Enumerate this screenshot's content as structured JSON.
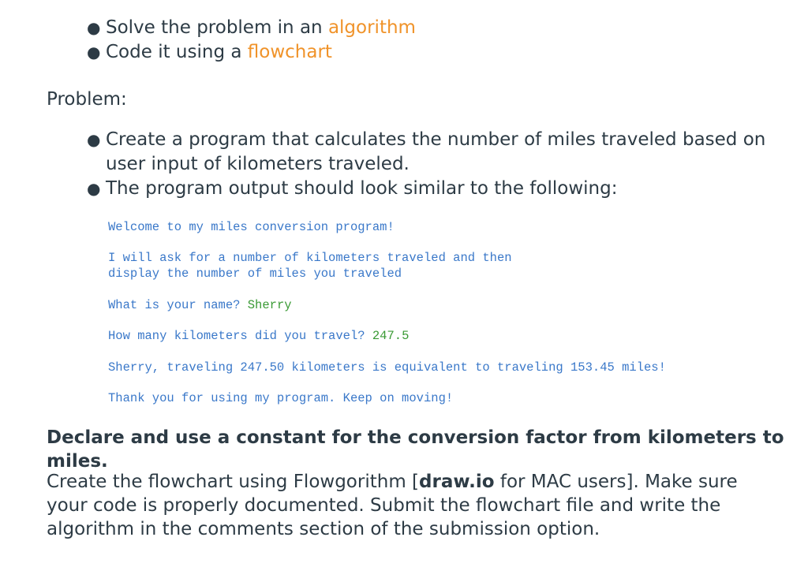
{
  "intro_list": [
    {
      "text": "Solve the problem in an ",
      "highlight": "algorithm"
    },
    {
      "text": "Code it using a ",
      "highlight": "flowchart"
    }
  ],
  "problem_label": "Problem:",
  "problem_list": [
    "Create a program that calculates the number of miles traveled based on user input of kilometers traveled.",
    "The program output should look similar to the following:"
  ],
  "sample_output": {
    "line1": "Welcome to my miles conversion program!",
    "line2a": "I will ask for a number of kilometers traveled and then",
    "line2b": "display the number of miles you traveled",
    "line3_prompt": "What is your name? ",
    "line3_input": "Sherry",
    "line4_prompt": "How many kilometers did you travel? ",
    "line4_input": "247.5",
    "line5": "Sherry, traveling 247.50 kilometers is equivalent to traveling 153.45 miles!",
    "line6": "Thank you for using my program. Keep on moving!"
  },
  "constant_note": "Declare and use a constant for the conversion factor from kilometers to miles.",
  "final_para": {
    "part1": "Create the flowchart using Flowgorithm [",
    "bold": "draw.io",
    "part2": " for MAC users].  Make sure your code is properly documented.  Submit the flowchart file and write the algorithm in the comments section of the submission option."
  },
  "colors": {
    "accent": "#f0932a",
    "code_blue": "#3a78c9",
    "code_green": "#3a9a35",
    "text": "#2d3b45"
  }
}
